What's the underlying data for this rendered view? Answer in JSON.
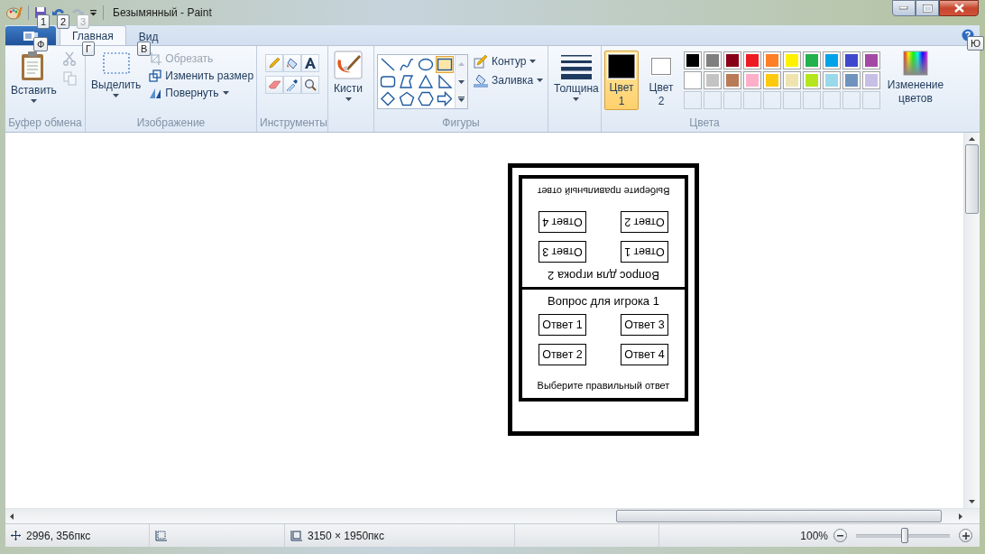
{
  "window": {
    "title": "Безымянный - Paint"
  },
  "quick_access": [
    {
      "kind": "save",
      "keytip": "1",
      "disabled": false
    },
    {
      "kind": "undo",
      "keytip": "2",
      "disabled": false
    },
    {
      "kind": "redo",
      "keytip": "3",
      "disabled": true
    }
  ],
  "file_menu": {
    "keytip": "Ф"
  },
  "tabs": [
    {
      "label": "Главная",
      "keytip": "Г",
      "selected": true
    },
    {
      "label": "Вид",
      "keytip": "В",
      "selected": false
    }
  ],
  "help": {
    "keytip": "Ю"
  },
  "ribbon": {
    "clipboard": {
      "label": "Буфер обмена",
      "paste": "Вставить",
      "cut_disabled": true,
      "copy_disabled": true
    },
    "image": {
      "label": "Изображение",
      "select": "Выделить",
      "crop": {
        "label": "Обрезать",
        "disabled": true
      },
      "resize": "Изменить размер",
      "rotate": "Повернуть"
    },
    "tools": {
      "label": "Инструменты"
    },
    "brushes": {
      "label": "Кисти"
    },
    "shapes": {
      "label": "Фигуры",
      "outline": "Контур",
      "fill": "Заливка",
      "items": [
        {
          "kind": "line",
          "selected": false
        },
        {
          "kind": "curve",
          "selected": false
        },
        {
          "kind": "oval",
          "selected": false
        },
        {
          "kind": "rectangle",
          "selected": true
        },
        {
          "kind": "rounded-rectangle",
          "selected": false
        },
        {
          "kind": "polygon",
          "selected": false
        },
        {
          "kind": "triangle",
          "selected": false
        },
        {
          "kind": "right-triangle",
          "selected": false
        },
        {
          "kind": "diamond",
          "selected": false
        },
        {
          "kind": "pentagon",
          "selected": false
        },
        {
          "kind": "hexagon",
          "selected": false
        },
        {
          "kind": "arrow",
          "selected": false
        }
      ]
    },
    "size": {
      "label": "Толщина"
    },
    "colors": {
      "label": "Цвета",
      "edit": "Изменение цветов",
      "slots": [
        {
          "label": "Цвет 1",
          "color": "#000000",
          "selected": true
        },
        {
          "label": "Цвет 2",
          "color": "#ffffff",
          "selected": false
        }
      ],
      "palette": [
        {
          "color": "#000000"
        },
        {
          "color": "#7f7f7f"
        },
        {
          "color": "#880015"
        },
        {
          "color": "#ed1c24"
        },
        {
          "color": "#ff7f27"
        },
        {
          "color": "#fff200"
        },
        {
          "color": "#22b14c"
        },
        {
          "color": "#00a2e8"
        },
        {
          "color": "#3f48cc"
        },
        {
          "color": "#a349a4"
        },
        {
          "color": "#ffffff"
        },
        {
          "color": "#c3c3c3"
        },
        {
          "color": "#b97a57"
        },
        {
          "color": "#ffaec9"
        },
        {
          "color": "#ffc90e"
        },
        {
          "color": "#efe4b0"
        },
        {
          "color": "#b5e61d"
        },
        {
          "color": "#99d9ea"
        },
        {
          "color": "#7092be"
        },
        {
          "color": "#c8bfe7"
        }
      ]
    }
  },
  "canvas": {
    "players": [
      {
        "upside_down": true,
        "question": "Вопрос для игрока 2",
        "answers": [
          "Ответ 1",
          "Ответ 3",
          "Ответ 2",
          "Ответ 4"
        ],
        "instruction": "Выберите правильный ответ"
      },
      {
        "upside_down": false,
        "question": "Вопрос для игрока 1",
        "answers": [
          "Ответ 1",
          "Ответ 3",
          "Ответ 2",
          "Ответ 4"
        ],
        "instruction": "Выберите правильный ответ"
      }
    ]
  },
  "status_bar": {
    "position": "2996, 356пкс",
    "canvas_size": "3150 × 1950пкс",
    "zoom": "100%",
    "zoom_level": {
      "level": 0.52
    }
  }
}
